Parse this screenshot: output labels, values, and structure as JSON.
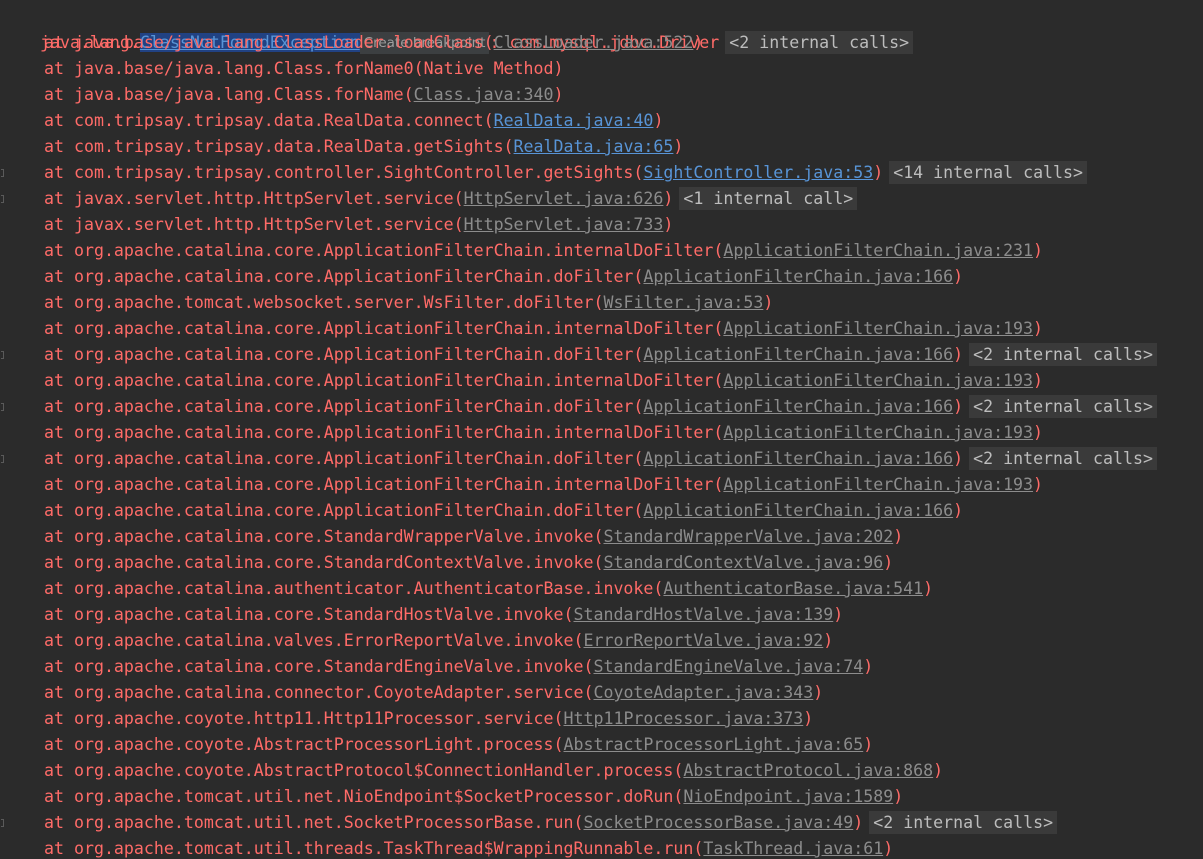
{
  "exception": {
    "prefix": "java.lang.",
    "class_name": "ClassNotFoundException",
    "breakpoint_hint": "Create breakpoint",
    "separator": ": ",
    "message": "com.mysql.jdbc.Driver",
    "internal_calls": "<2 internal calls>"
  },
  "stack": [
    {
      "method": "at java.base/java.lang.ClassLoader.loadClass(",
      "file": "ClassLoader.java:522",
      "link_style": "grey",
      "fold": "",
      "gutter": false
    },
    {
      "method": "at java.base/java.lang.Class.forName0(Native Method)",
      "file": "",
      "link_style": "",
      "fold": "",
      "gutter": false
    },
    {
      "method": "at java.base/java.lang.Class.forName(",
      "file": "Class.java:340",
      "link_style": "grey",
      "fold": "",
      "gutter": false
    },
    {
      "method": "at com.tripsay.tripsay.data.RealData.connect(",
      "file": "RealData.java:40",
      "link_style": "blue",
      "fold": "",
      "gutter": false
    },
    {
      "method": "at com.tripsay.tripsay.data.RealData.getSights(",
      "file": "RealData.java:65",
      "link_style": "blue",
      "fold": "",
      "gutter": false
    },
    {
      "method": "at com.tripsay.tripsay.controller.SightController.getSights(",
      "file": "SightController.java:53",
      "link_style": "blue",
      "fold": "<14 internal calls>",
      "gutter": true
    },
    {
      "method": "at javax.servlet.http.HttpServlet.service(",
      "file": "HttpServlet.java:626",
      "link_style": "grey",
      "fold": "<1 internal call>",
      "gutter": true
    },
    {
      "method": "at javax.servlet.http.HttpServlet.service(",
      "file": "HttpServlet.java:733",
      "link_style": "grey",
      "fold": "",
      "gutter": false
    },
    {
      "method": "at org.apache.catalina.core.ApplicationFilterChain.internalDoFilter(",
      "file": "ApplicationFilterChain.java:231",
      "link_style": "grey",
      "fold": "",
      "gutter": false
    },
    {
      "method": "at org.apache.catalina.core.ApplicationFilterChain.doFilter(",
      "file": "ApplicationFilterChain.java:166",
      "link_style": "grey",
      "fold": "",
      "gutter": false
    },
    {
      "method": "at org.apache.tomcat.websocket.server.WsFilter.doFilter(",
      "file": "WsFilter.java:53",
      "link_style": "grey",
      "fold": "",
      "gutter": false
    },
    {
      "method": "at org.apache.catalina.core.ApplicationFilterChain.internalDoFilter(",
      "file": "ApplicationFilterChain.java:193",
      "link_style": "grey",
      "fold": "",
      "gutter": false
    },
    {
      "method": "at org.apache.catalina.core.ApplicationFilterChain.doFilter(",
      "file": "ApplicationFilterChain.java:166",
      "link_style": "grey",
      "fold": "<2 internal calls>",
      "gutter": true
    },
    {
      "method": "at org.apache.catalina.core.ApplicationFilterChain.internalDoFilter(",
      "file": "ApplicationFilterChain.java:193",
      "link_style": "grey",
      "fold": "",
      "gutter": false
    },
    {
      "method": "at org.apache.catalina.core.ApplicationFilterChain.doFilter(",
      "file": "ApplicationFilterChain.java:166",
      "link_style": "grey",
      "fold": "<2 internal calls>",
      "gutter": true
    },
    {
      "method": "at org.apache.catalina.core.ApplicationFilterChain.internalDoFilter(",
      "file": "ApplicationFilterChain.java:193",
      "link_style": "grey",
      "fold": "",
      "gutter": false
    },
    {
      "method": "at org.apache.catalina.core.ApplicationFilterChain.doFilter(",
      "file": "ApplicationFilterChain.java:166",
      "link_style": "grey",
      "fold": "<2 internal calls>",
      "gutter": true
    },
    {
      "method": "at org.apache.catalina.core.ApplicationFilterChain.internalDoFilter(",
      "file": "ApplicationFilterChain.java:193",
      "link_style": "grey",
      "fold": "",
      "gutter": false
    },
    {
      "method": "at org.apache.catalina.core.ApplicationFilterChain.doFilter(",
      "file": "ApplicationFilterChain.java:166",
      "link_style": "grey",
      "fold": "",
      "gutter": false
    },
    {
      "method": "at org.apache.catalina.core.StandardWrapperValve.invoke(",
      "file": "StandardWrapperValve.java:202",
      "link_style": "grey",
      "fold": "",
      "gutter": false
    },
    {
      "method": "at org.apache.catalina.core.StandardContextValve.invoke(",
      "file": "StandardContextValve.java:96",
      "link_style": "grey",
      "fold": "",
      "gutter": false
    },
    {
      "method": "at org.apache.catalina.authenticator.AuthenticatorBase.invoke(",
      "file": "AuthenticatorBase.java:541",
      "link_style": "grey",
      "fold": "",
      "gutter": false
    },
    {
      "method": "at org.apache.catalina.core.StandardHostValve.invoke(",
      "file": "StandardHostValve.java:139",
      "link_style": "grey",
      "fold": "",
      "gutter": false
    },
    {
      "method": "at org.apache.catalina.valves.ErrorReportValve.invoke(",
      "file": "ErrorReportValve.java:92",
      "link_style": "grey",
      "fold": "",
      "gutter": false
    },
    {
      "method": "at org.apache.catalina.core.StandardEngineValve.invoke(",
      "file": "StandardEngineValve.java:74",
      "link_style": "grey",
      "fold": "",
      "gutter": false
    },
    {
      "method": "at org.apache.catalina.connector.CoyoteAdapter.service(",
      "file": "CoyoteAdapter.java:343",
      "link_style": "grey",
      "fold": "",
      "gutter": false
    },
    {
      "method": "at org.apache.coyote.http11.Http11Processor.service(",
      "file": "Http11Processor.java:373",
      "link_style": "grey",
      "fold": "",
      "gutter": false
    },
    {
      "method": "at org.apache.coyote.AbstractProcessorLight.process(",
      "file": "AbstractProcessorLight.java:65",
      "link_style": "grey",
      "fold": "",
      "gutter": false
    },
    {
      "method": "at org.apache.coyote.AbstractProtocol$ConnectionHandler.process(",
      "file": "AbstractProtocol.java:868",
      "link_style": "grey",
      "fold": "",
      "gutter": false
    },
    {
      "method": "at org.apache.tomcat.util.net.NioEndpoint$SocketProcessor.doRun(",
      "file": "NioEndpoint.java:1589",
      "link_style": "grey",
      "fold": "",
      "gutter": false
    },
    {
      "method": "at org.apache.tomcat.util.net.SocketProcessorBase.run(",
      "file": "SocketProcessorBase.java:49",
      "link_style": "grey",
      "fold": "<2 internal calls>",
      "gutter": true
    },
    {
      "method": "at org.apache.tomcat.util.threads.TaskThread$WrappingRunnable.run(",
      "file": "TaskThread.java:61",
      "link_style": "grey",
      "fold": "",
      "gutter": false
    }
  ]
}
